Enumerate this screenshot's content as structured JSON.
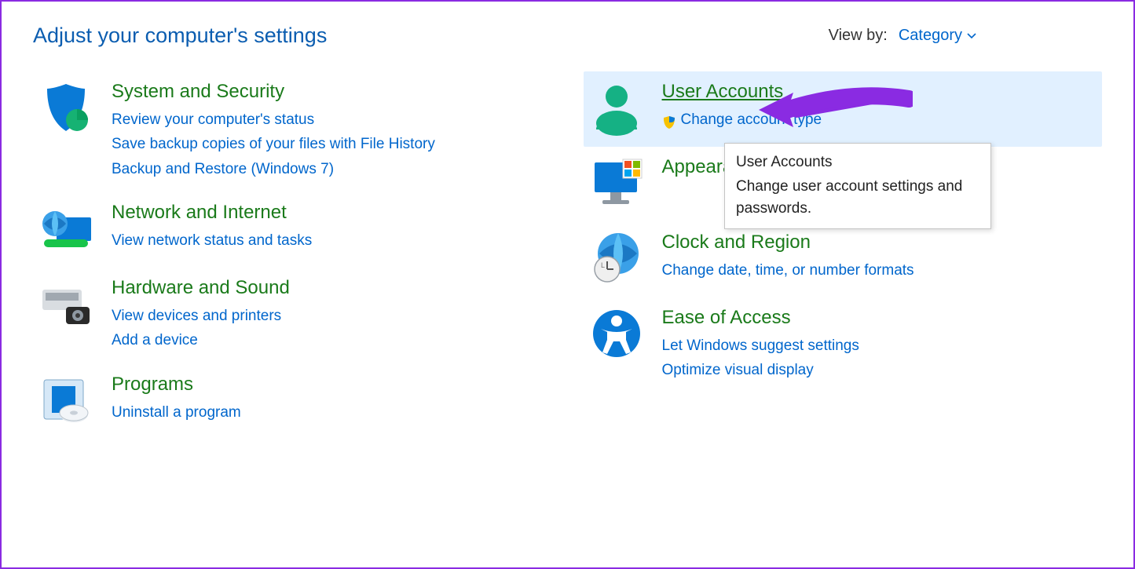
{
  "header": {
    "title": "Adjust your computer's settings",
    "view_by_label": "View by:",
    "view_by_value": "Category"
  },
  "left": [
    {
      "title": "System and Security",
      "links": [
        {
          "text": "Review your computer's status"
        },
        {
          "text": "Save backup copies of your files with File History"
        },
        {
          "text": "Backup and Restore (Windows 7)"
        }
      ]
    },
    {
      "title": "Network and Internet",
      "links": [
        {
          "text": "View network status and tasks"
        }
      ]
    },
    {
      "title": "Hardware and Sound",
      "links": [
        {
          "text": "View devices and printers"
        },
        {
          "text": "Add a device"
        }
      ]
    },
    {
      "title": "Programs",
      "links": [
        {
          "text": "Uninstall a program"
        }
      ]
    }
  ],
  "right": [
    {
      "title": "User Accounts",
      "hovered": true,
      "highlight": true,
      "links": [
        {
          "text": "Change account type",
          "shield": true
        }
      ]
    },
    {
      "title": "Appearance and Personalization",
      "truncated_title": "Appearance a",
      "links": []
    },
    {
      "title": "Clock and Region",
      "links": [
        {
          "text": "Change date, time, or number formats"
        }
      ]
    },
    {
      "title": "Ease of Access",
      "links": [
        {
          "text": "Let Windows suggest settings"
        },
        {
          "text": "Optimize visual display"
        }
      ]
    }
  ],
  "tooltip": {
    "title": "User Accounts",
    "body": "Change user account settings and passwords."
  },
  "annotation": {
    "arrow_color": "#8a2be2"
  }
}
